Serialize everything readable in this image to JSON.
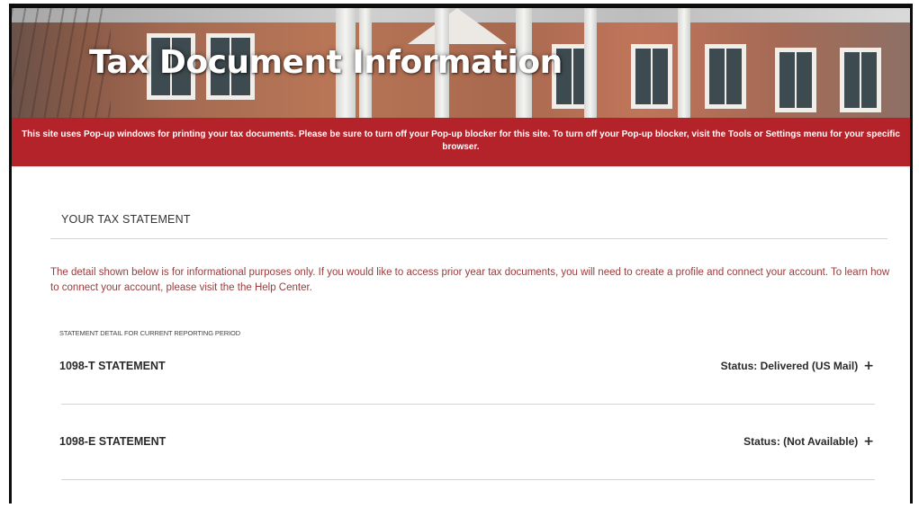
{
  "header": {
    "title": "Tax Document Information"
  },
  "notice": {
    "text": "This site uses Pop-up windows for printing your tax documents. Please be sure to turn off your Pop-up blocker for this site. To turn off your Pop-up blocker, visit the Tools or Settings menu for your specific browser."
  },
  "main": {
    "section_title": "YOUR TAX STATEMENT",
    "info_text": "The detail shown below is for informational purposes only. If you would like to access prior year tax documents, you will need to create a profile and connect your account. To learn how to connect your account, please visit the the Help Center.",
    "period_label": "STATEMENT DETAIL FOR CURRENT REPORTING PERIOD",
    "statements": [
      {
        "name": "1098-T STATEMENT",
        "status": "Status: Delivered (US Mail)",
        "expand": "+"
      },
      {
        "name": "1098-E STATEMENT",
        "status": "Status: (Not Available)",
        "expand": "+"
      }
    ]
  },
  "colors": {
    "notice_bg": "#b5232a",
    "info_text": "#9b3b3b",
    "rule": "#d4d4d4"
  },
  "icons": {
    "expand": "plus-icon"
  }
}
